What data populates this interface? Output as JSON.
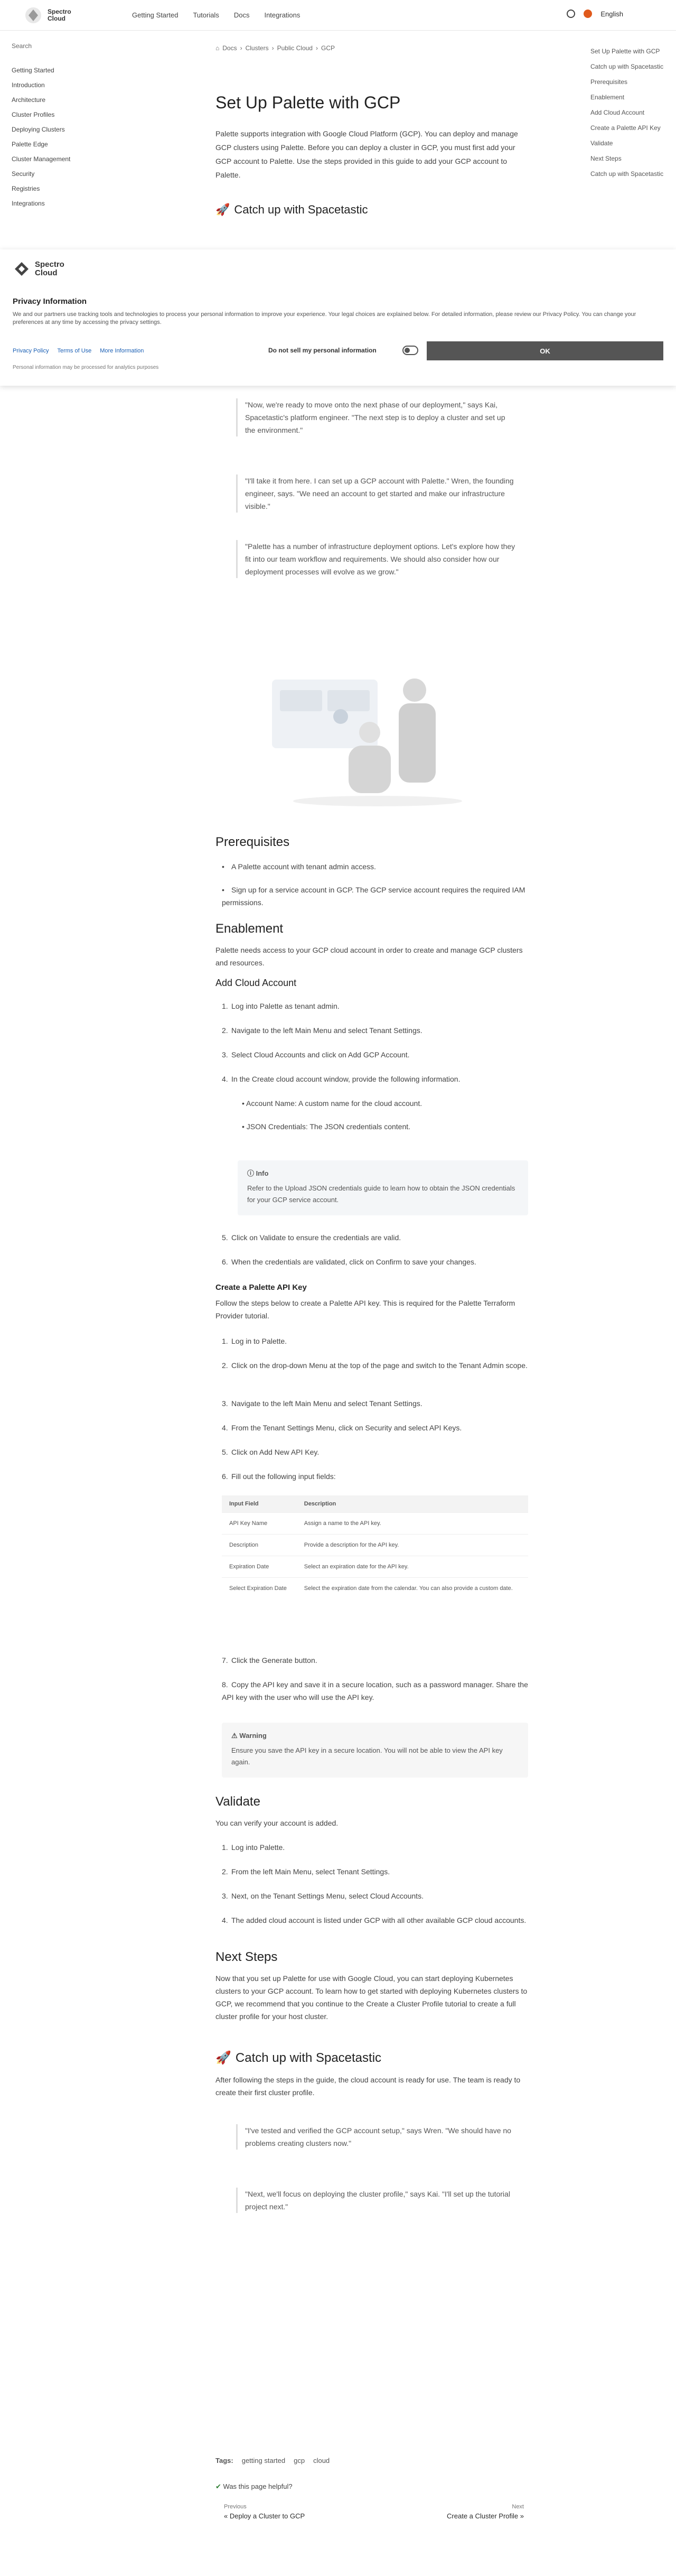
{
  "header": {
    "logo_text": [
      "Spectro",
      "Cloud"
    ],
    "nav": [
      "Getting Started",
      "Tutorials",
      "Docs",
      "Integrations"
    ],
    "language": "English"
  },
  "sidebar": {
    "search_placeholder": "Search",
    "items": [
      "Getting Started",
      "Introduction",
      "Architecture",
      "Cluster Profiles",
      "Deploying Clusters",
      "Palette Edge",
      "Cluster Management",
      "Security",
      "Registries",
      "Integrations"
    ]
  },
  "breadcrumbs": [
    "Docs",
    "Clusters",
    "Public Cloud",
    "GCP"
  ],
  "title": "Set Up Palette with GCP",
  "intro": "Palette supports integration with Google Cloud Platform (GCP). You can deploy and manage GCP clusters using Palette. Before you can deploy a cluster in GCP, you must first add your GCP account to Palette. Use the steps provided in this guide to add your GCP account to Palette.",
  "toc": [
    "Set Up Palette with GCP",
    "Catch up with Spacetastic",
    "Prerequisites",
    "Enablement",
    "Add Cloud Account",
    "Create a Palette API Key",
    "Validate",
    "Next Steps",
    "Catch up with Spacetastic"
  ],
  "catchup_heading": "Catch up with Spacetastic",
  "cookie": {
    "logo_text": [
      "Spectro",
      "Cloud"
    ],
    "title": "Privacy Information",
    "text": "We and our partners use tracking tools and technologies to process your personal information to improve your experience. Your legal choices are explained below. For detailed information, please review our Privacy Policy. You can change your preferences at any time by accessing the privacy settings.",
    "links": [
      "Privacy Policy",
      "Terms of Use",
      "More Information"
    ],
    "pref_text": "Personal information may be processed for analytics purposes",
    "toggle_label": "Do not sell my personal information",
    "ok_label": "OK"
  },
  "quotes_top": [
    "\"Now, we're ready to move onto the next phase of our deployment,\" says Kai, Spacetastic's platform engineer. \"The next step is to deploy a cluster and set up the environment.\"",
    "\"I'll take it from here. I can set up a GCP account with Palette.\" Wren, the founding engineer, says. \"We need an account to get started and make our infrastructure visible.\"",
    "\"Palette has a number of infrastructure deployment options. Let's explore how they fit into our team workflow and requirements. We should also consider how our deployment processes will evolve as we grow.\""
  ],
  "prerequisites": {
    "heading": "Prerequisites",
    "items": [
      "A Palette account with tenant admin access.",
      "Sign up for a service account in GCP. The GCP service account requires the required IAM permissions."
    ]
  },
  "enablement": {
    "heading": "Enablement",
    "text": "Palette needs access to your GCP cloud account in order to create and manage GCP clusters and resources."
  },
  "add_account": {
    "heading": "Add Cloud Account",
    "steps": [
      "Log into Palette as tenant admin.",
      "Navigate to the left Main Menu and select Tenant Settings.",
      "Select Cloud Accounts and click on Add GCP Account.",
      "In the Create cloud account window, provide the following information."
    ],
    "sub": [
      "Account Name: A custom name for the cloud account.",
      "JSON Credentials: The JSON credentials content."
    ],
    "note_title": "Info",
    "note_text": "Refer to the Upload JSON credentials guide to learn how to obtain the JSON credentials for your GCP service account.",
    "steps2": [
      "Click on Validate to ensure the credentials are valid.",
      "When the credentials are validated, click on Confirm to save your changes."
    ]
  },
  "api_key": {
    "heading": "Create a Palette API Key",
    "intro": "Follow the steps below to create a Palette API key. This is required for the Palette Terraform Provider tutorial.",
    "steps": [
      "Log in to Palette.",
      "Click on the drop-down Menu at the top of the page and switch to the Tenant Admin scope.",
      "Navigate to the left Main Menu and select Tenant Settings.",
      "From the Tenant Settings Menu, click on Security and select API Keys.",
      "Click on Add New API Key.",
      "Fill out the following input fields:"
    ],
    "table_headers": [
      "Input Field",
      "Description"
    ],
    "table_rows": [
      [
        "API Key Name",
        "Assign a name to the API key."
      ],
      [
        "Description",
        "Provide a description for the API key."
      ],
      [
        "Expiration Date",
        "Select an expiration date for the API key."
      ],
      [
        "Select Expiration Date",
        "Select the expiration date from the calendar. You can also provide a custom date."
      ]
    ],
    "steps2": [
      "Click the Generate button.",
      "Copy the API key and save it in a secure location, such as a password manager. Share the API key with the user who will use the API key."
    ],
    "warn_title": "Warning",
    "warn_text": "Ensure you save the API key in a secure location. You will not be able to view the API key again."
  },
  "validate": {
    "heading": "Validate",
    "intro": "You can verify your account is added.",
    "steps": [
      "Log into Palette.",
      "From the left Main Menu, select Tenant Settings.",
      "Next, on the Tenant Settings Menu, select Cloud Accounts.",
      "The added cloud account is listed under GCP with all other available GCP cloud accounts."
    ]
  },
  "next_steps": {
    "heading": "Next Steps",
    "text": "Now that you set up Palette for use with Google Cloud, you can start deploying Kubernetes clusters to your GCP account. To learn how to get started with deploying Kubernetes clusters to GCP, we recommend that you continue to the Create a Cluster Profile tutorial to create a full cluster profile for your host cluster."
  },
  "catchup2": {
    "heading": "Catch up with Spacetastic",
    "intro": "After following the steps in the guide, the cloud account is ready for use. The team is ready to create their first cluster profile.",
    "quotes": [
      "\"I've tested and verified the GCP account setup,\" says Wren. \"We should have no problems creating clusters now.\"",
      "\"Next, we'll focus on deploying the cluster profile,\" says Kai. \"I'll set up the tutorial project next.\""
    ]
  },
  "tags": {
    "label": "Tags:",
    "items": [
      "getting started",
      "gcp",
      "cloud"
    ]
  },
  "helpful": "Was this page helpful?",
  "prev": {
    "label": "Previous",
    "title": "« Deploy a Cluster to GCP"
  },
  "next": {
    "label": "Next",
    "title": "Create a Cluster Profile »"
  }
}
